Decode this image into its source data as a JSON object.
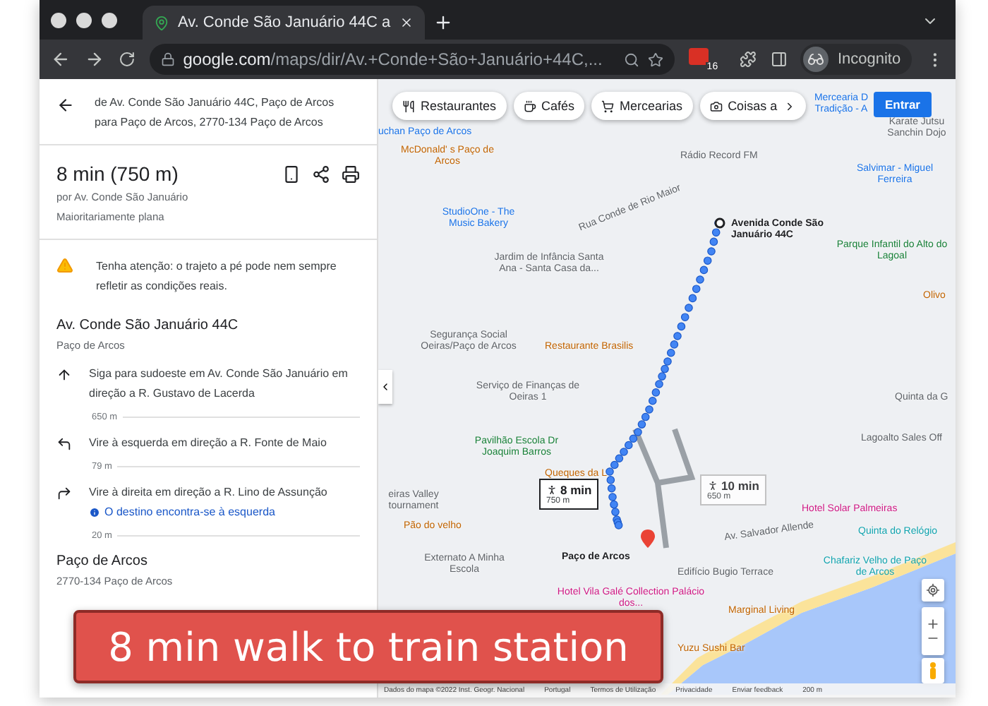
{
  "browser": {
    "tab": {
      "title": "Av. Conde São Januário 44C a",
      "selected": true
    },
    "address": {
      "domain": "google.com",
      "path": "/maps/dir/Av.+Conde+São+Januário+44C,..."
    },
    "extension_badge": "16",
    "profile": "Incognito"
  },
  "directions": {
    "from": "de Av. Conde São Januário 44C, Paço de Arcos",
    "to": "para Paço de Arcos, 2770-134 Paço de Arcos",
    "summary": "8 min (750 m)",
    "via": "por Av. Conde São Januário",
    "terrain": "Maioritariamente plana",
    "warning": "Tenha atenção: o trajeto a pé pode nem sempre refletir as condições reais.",
    "start": {
      "name": "Av. Conde São Januário 44C",
      "locality": "Paço de Arcos"
    },
    "steps": [
      {
        "kind": "straight",
        "text": "Siga para sudoeste em Av. Conde São Januário em direção a R. Gustavo de Lacerda",
        "distance": "650 m"
      },
      {
        "kind": "left",
        "text": "Vire à esquerda em direção a R. Fonte de Maio",
        "distance": "79 m"
      },
      {
        "kind": "right",
        "text": "Vire à direita em direção a R. Lino de Assunção",
        "note": "O destino encontra-se à esquerda",
        "distance": "20 m"
      }
    ],
    "destination": {
      "name": "Paço de Arcos",
      "address": "2770-134 Paço de Arcos"
    }
  },
  "map": {
    "chips": [
      {
        "kind": "food",
        "label": "Restaurantes"
      },
      {
        "kind": "cafe",
        "label": "Cafés"
      },
      {
        "kind": "grocery",
        "label": "Mercearias"
      },
      {
        "kind": "things",
        "label": "Coisas a"
      }
    ],
    "sign_in": "Entrar",
    "labels": [
      {
        "kind": "shop",
        "text": "uchan Paço de Arcos"
      },
      {
        "kind": "food",
        "text": "McDonald' s Paço de Arcos"
      },
      {
        "kind": "place",
        "text": "Rádio Record FM"
      },
      {
        "kind": "place",
        "text": "Karate Jutsu Sanchin Dojo"
      },
      {
        "kind": "shop",
        "text": "Mercearia D Tradição - A"
      },
      {
        "kind": "shop",
        "text": "Salvimar - Miguel Ferreira"
      },
      {
        "kind": "road",
        "text": "Rua Conde de Rio Maior"
      },
      {
        "kind": "shop",
        "text": "StudioOne - The Music Bakery"
      },
      {
        "kind": "place",
        "text": "Jardim de Infância Santa Ana - Santa Casa da..."
      },
      {
        "kind": "park",
        "text": "Parque Infantil do Alto do Lagoal"
      },
      {
        "kind": "food",
        "text": "Olivo"
      },
      {
        "kind": "place",
        "text": "Segurança Social Oeiras/Paço de Arcos"
      },
      {
        "kind": "food",
        "text": "Restaurante Brasilis"
      },
      {
        "kind": "place",
        "text": "Serviço de Finanças de Oeiras 1"
      },
      {
        "kind": "place",
        "text": "Quinta da G"
      },
      {
        "kind": "park",
        "text": "Pavilhão Escola Dr Joaquim Barros"
      },
      {
        "kind": "place",
        "text": "Lagoalto Sales Off"
      },
      {
        "kind": "food",
        "text": "Queques da L"
      },
      {
        "kind": "place",
        "text": "eiras Valley tournament"
      },
      {
        "kind": "hotel",
        "text": "Hotel Solar Palmeiras"
      },
      {
        "kind": "food",
        "text": "Pão do velho"
      },
      {
        "kind": "road",
        "text": "Av. Salvador Allende"
      },
      {
        "kind": "landmark",
        "text": "Quinta do Relógio"
      },
      {
        "kind": "place",
        "text": "Externato A Minha Escola"
      },
      {
        "kind": "place",
        "text": "Edifício Bugio Terrace"
      },
      {
        "kind": "landmark",
        "text": "Chafariz Velho de Paço de Arcos"
      },
      {
        "kind": "hotel",
        "text": "Hotel Vila Galé Collection Palácio dos..."
      },
      {
        "kind": "food",
        "text": "Marginal Living"
      },
      {
        "kind": "food",
        "text": "Yuzu Sushi Bar"
      }
    ],
    "origin": "Avenida Conde São Januário 44C",
    "destination": "Paço de Arcos",
    "routes": [
      {
        "duration": "8 min",
        "distance": "750 m",
        "selected": true
      },
      {
        "duration": "10 min",
        "distance": "650 m",
        "selected": false
      }
    ],
    "footer": [
      "Dados do mapa ©2022 Inst. Geogr. Nacional",
      "Portugal",
      "Termos de Utilização",
      "Privacidade",
      "Enviar feedback",
      "200 m"
    ]
  },
  "caption": "8 min walk to train station"
}
